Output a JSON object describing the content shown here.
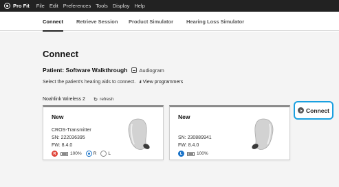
{
  "menubar": {
    "app_name": "Pro Fit",
    "menus": [
      "File",
      "Edit",
      "Preferences",
      "Tools",
      "Display",
      "Help"
    ]
  },
  "tabs": [
    {
      "label": "Connect",
      "active": true
    },
    {
      "label": "Retrieve Session",
      "active": false
    },
    {
      "label": "Product Simulator",
      "active": false
    },
    {
      "label": "Hearing Loss Simulator",
      "active": false
    }
  ],
  "page": {
    "title": "Connect",
    "patient_label": "Patient: Software Walkthrough",
    "audiogram_label": "Audiogram",
    "instruction": "Select the patient's hearing aids to connect.",
    "view_programmers_label": "View programmers",
    "noahlink_label": "Noahlink Wireless 2",
    "refresh_label": "refresh"
  },
  "devices": [
    {
      "title": "New",
      "model": "CROS-Transmitter",
      "serial": "SN: 222036395",
      "firmware": "FW: 8.4.0",
      "side_badge": "R",
      "side_color": "#e0453a",
      "battery": "100%",
      "side_options": [
        "R",
        "L"
      ],
      "selected_side": "R"
    },
    {
      "title": "New",
      "model": "",
      "serial": "SN: 230889941",
      "firmware": "FW: 8.4.0",
      "side_badge": "L",
      "side_color": "#1a73c8",
      "battery": "100%"
    }
  ],
  "connect_button": {
    "label": "Connect"
  },
  "colors": {
    "accent": "#1aa0e0",
    "right": "#e0453a",
    "left": "#1a73c8"
  }
}
